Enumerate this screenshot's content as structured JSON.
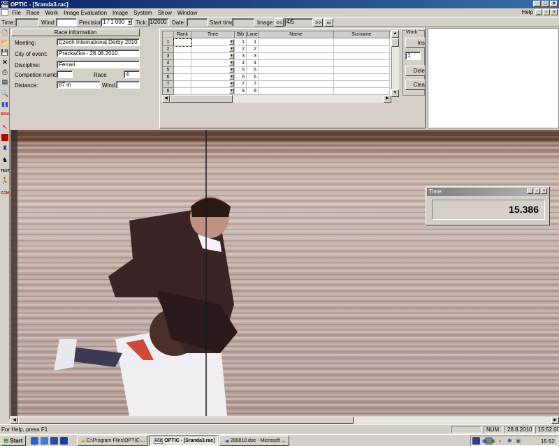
{
  "window": {
    "title": "OPTIC - [Sranda3.rac]",
    "minimize": "_",
    "maximize": "□",
    "close": "×"
  },
  "menu": {
    "items": [
      "File",
      "Race",
      "Work",
      "Image Evaluation",
      "Image",
      "System",
      "Show",
      "Window"
    ],
    "help": "Help"
  },
  "toolbar": {
    "time_label": "Time:",
    "time_value": "",
    "wind_label": "Wind:",
    "wind_value": "",
    "precision_label": "Precision:",
    "precision_value": "1 / 1 000",
    "tick_label": "Tick:",
    "tick_value": "1/2000",
    "date_label": "Date:",
    "date_value": "",
    "start_time_label": "Start time",
    "start_time_value": "",
    "image_label": "Image:",
    "image_prev": "<<",
    "image_value": "4/5",
    "image_next": ">>",
    "image_fit": "∞"
  },
  "left_tools": [
    "new-icon",
    "open-icon",
    "save-icon",
    "delete-icon",
    "print-icon",
    "layout-icon",
    "zoom-icon",
    "bars-icon",
    "logo-icon",
    "cursor-icon",
    "red-square-icon",
    "runner-icon",
    "horse-icon",
    "test-icon",
    "hurdler-icon",
    "com-icon"
  ],
  "race_info": {
    "header": "Race information",
    "meeting_label": "Meeting:",
    "meeting_value": "Czech International Derby 2010",
    "city_label": "City of event:",
    "city_value": "Prackačka - 28.08.2010",
    "discipline_label": "Discipline:",
    "discipline_value": "Ferrari",
    "competition_label": "Competion number:",
    "competition_value": "",
    "race_label": "Race",
    "race_value": "4",
    "distance_label": "Distance:",
    "distance_value": "87 m",
    "wind_label": "Wind:",
    "wind_value": ""
  },
  "grid": {
    "headers": [
      "Rank",
      "Time",
      "Bib",
      "Lane",
      "Name",
      "Surname"
    ],
    "rows": [
      {
        "n": "1",
        "bib": "1",
        "lane": "1"
      },
      {
        "n": "2",
        "bib": "2",
        "lane": "2"
      },
      {
        "n": "3",
        "bib": "3",
        "lane": "3"
      },
      {
        "n": "4",
        "bib": "4",
        "lane": "4"
      },
      {
        "n": "5",
        "bib": "5",
        "lane": "5"
      },
      {
        "n": "6",
        "bib": "6",
        "lane": "6"
      },
      {
        "n": "7",
        "bib": "7",
        "lane": "7"
      },
      {
        "n": "8",
        "bib": "8",
        "lane": "8"
      }
    ]
  },
  "work": {
    "caption": "Work",
    "insert": "Ins",
    "spinner_value": "1",
    "delete": "Dele",
    "clear": "Clea"
  },
  "time_window": {
    "title": "Time:",
    "value": "15.386"
  },
  "status": {
    "help_text": "For Help, press F1",
    "num": "NUM",
    "date": "28.8.2010",
    "time": "15:52:00"
  },
  "taskbar": {
    "start": "Start",
    "tasks": [
      "C:\\Program Files\\OPTIC-...",
      "OPTIC - [Sranda3.rac]",
      "280810.doc - Microsoft ..."
    ],
    "clock": "15:52"
  }
}
